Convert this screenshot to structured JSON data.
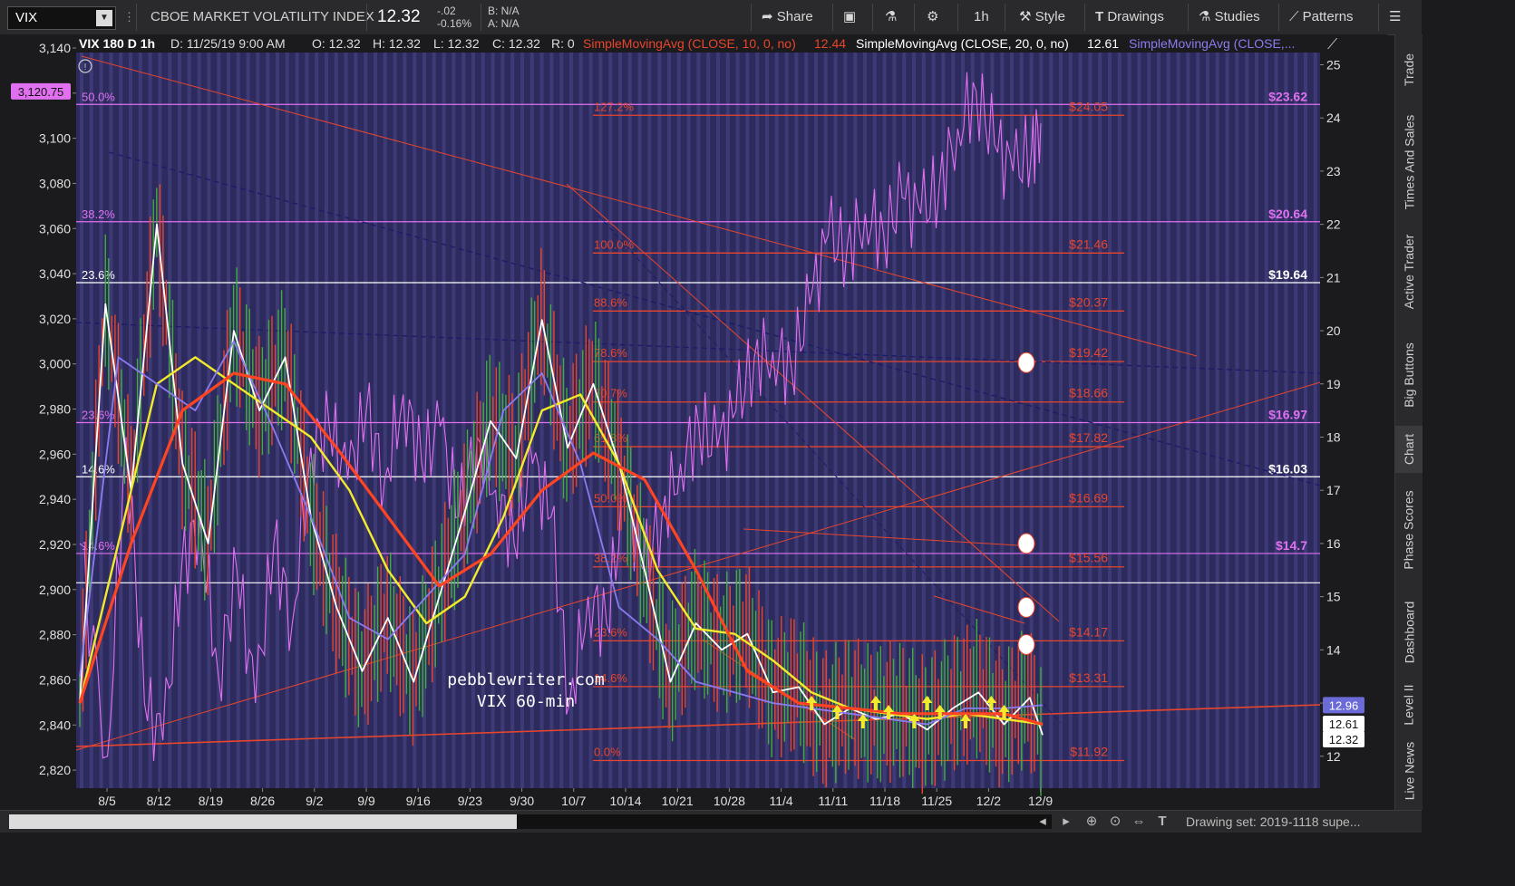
{
  "header": {
    "symbol": "VIX",
    "title": "CBOE MARKET VOLATILITY INDEX",
    "last": "12.32",
    "change": "-.02",
    "change_pct": "-0.16%",
    "bid": "B: N/A",
    "ask": "A: N/A",
    "buttons": {
      "share": "Share",
      "timeframe": "1h",
      "style": "Style",
      "drawings": "Drawings",
      "studies": "Studies",
      "patterns": "Patterns"
    }
  },
  "info_bar": {
    "symbol_tf": "VIX 180 D 1h",
    "date": "D: 11/25/19 9:00 AM",
    "open": "O: 12.32",
    "high": "H: 12.32",
    "low": "L: 12.32",
    "close": "C: 12.32",
    "range": "R: 0",
    "sma10": "SimpleMovingAvg (CLOSE, 10, 0, no)",
    "sma10_val": "12.44",
    "sma20": "SimpleMovingAvg (CLOSE, 20, 0, no)",
    "sma20_val": "12.61",
    "sma50": "SimpleMovingAvg (CLOSE,..."
  },
  "right_tabs": [
    "Trade",
    "Times And Sales",
    "Active Trader",
    "Big Buttons",
    "Chart",
    "Phase Scores",
    "Dashboard",
    "Level II",
    "Live News"
  ],
  "bottom": {
    "drawing_set": "Drawing set: 2019-1118 supe..."
  },
  "colors": {
    "plot_bg": "#2d2b5e",
    "stripe": "#4a4788",
    "fib_red": "#e8452c",
    "magenta": "#e070f0",
    "sma10": "#ffffff",
    "sma20": "#f2ea2a",
    "sma50": "#8a7cf0",
    "sma_long": "#ff4422",
    "arrow": "#f2ea2a",
    "badge_magenta": "#e070f0",
    "badge_blue": "#6b6bd8"
  },
  "chart_data": {
    "type": "line",
    "watermark": [
      "pebblewriter.com",
      "VIX 60-min"
    ],
    "x_ticks": [
      "8/5",
      "8/12",
      "8/19",
      "8/26",
      "9/2",
      "9/9",
      "9/16",
      "9/23",
      "9/30",
      "10/7",
      "10/14",
      "10/21",
      "10/28",
      "11/4",
      "11/11",
      "11/18",
      "11/25",
      "12/2",
      "12/9"
    ],
    "left_axis": {
      "ticks": [
        2820,
        2840,
        2860,
        2880,
        2900,
        2920,
        2940,
        2960,
        2980,
        3000,
        3020,
        3040,
        3060,
        3080,
        3100,
        3120,
        3140
      ],
      "tick_labels": [
        "2,820",
        "2,840",
        "2,860",
        "2,880",
        "2,900",
        "2,920",
        "2,940",
        "2,960",
        "2,980",
        "3,000",
        "3,020",
        "3,040",
        "3,060",
        "3,080",
        "3,100",
        "3,120",
        "3,140"
      ],
      "range": [
        2812,
        3142
      ],
      "badge": "3,120.75",
      "badge_value": 3120.75
    },
    "right_axis": {
      "ticks": [
        12,
        13,
        14,
        15,
        16,
        17,
        18,
        19,
        20,
        21,
        22,
        23,
        24,
        25
      ],
      "range": [
        11.4,
        25.4
      ],
      "badges": [
        {
          "label": "12.96",
          "value": 12.96
        },
        {
          "label": "12.61",
          "value": 12.61
        },
        {
          "label": "12.32",
          "value": 12.32
        }
      ]
    },
    "spx_fib_lines": [
      {
        "left_label": "50.0%",
        "right_label": "$23.62",
        "value": 3115,
        "color": "#e070f0"
      },
      {
        "left_label": "38.2%",
        "right_label": "$20.64",
        "value": 3063,
        "color": "#e070f0"
      },
      {
        "left_label": "23.6%",
        "right_label": "$19.64",
        "value": 3036,
        "color": "#ffffff"
      },
      {
        "left_label": "23.6%",
        "right_label": "$16.97",
        "value": 2974,
        "color": "#e070f0"
      },
      {
        "left_label": "14.6%",
        "right_label": "$16.03",
        "value": 2950,
        "color": "#ffffff"
      },
      {
        "left_label": "14.6%",
        "right_label": "$14.7",
        "value": 2916,
        "color": "#e070f0"
      },
      {
        "left_label": "",
        "right_label": "",
        "value": 2903,
        "color": "#ffffff"
      }
    ],
    "vix_fib_levels": [
      {
        "label": "127.2%",
        "price": "$24.05",
        "value": 24.05
      },
      {
        "label": "100.0%",
        "price": "$21.46",
        "value": 21.46
      },
      {
        "label": "88.6%",
        "price": "$20.37",
        "value": 20.37
      },
      {
        "label": "78.6%",
        "price": "$19.42",
        "value": 19.42
      },
      {
        "label": "70.7%",
        "price": "$18.66",
        "value": 18.66
      },
      {
        "label": "61.8%",
        "price": "$17.82",
        "value": 17.82
      },
      {
        "label": "50.0%",
        "price": "$16.69",
        "value": 16.69
      },
      {
        "label": "38.2%",
        "price": "$15.56",
        "value": 15.56
      },
      {
        "label": "23.6%",
        "price": "$14.17",
        "value": 14.17
      },
      {
        "label": "14.6%",
        "price": "$13.31",
        "value": 13.31
      },
      {
        "label": "0.0%",
        "price": "$11.92",
        "value": 11.92
      }
    ],
    "spx_series_right_scale": [
      {
        "x": 0,
        "y": 16.0
      },
      {
        "x": 3,
        "y": 12.0
      },
      {
        "x": 5,
        "y": 18.0
      },
      {
        "x": 7,
        "y": 13.0
      },
      {
        "x": 9,
        "y": 12.3
      },
      {
        "x": 11,
        "y": 15.5
      },
      {
        "x": 13,
        "y": 16.5
      },
      {
        "x": 15,
        "y": 13.5
      },
      {
        "x": 17,
        "y": 15.5
      },
      {
        "x": 19,
        "y": 13.0
      },
      {
        "x": 21,
        "y": 16.0
      },
      {
        "x": 23,
        "y": 14.5
      },
      {
        "x": 25,
        "y": 17.8
      },
      {
        "x": 27,
        "y": 18.2
      },
      {
        "x": 29,
        "y": 17.2
      },
      {
        "x": 31,
        "y": 18.5
      },
      {
        "x": 33,
        "y": 17.2
      },
      {
        "x": 35,
        "y": 18.8
      },
      {
        "x": 37,
        "y": 17.5
      },
      {
        "x": 39,
        "y": 18.2
      },
      {
        "x": 41,
        "y": 16.5
      },
      {
        "x": 43,
        "y": 18.0
      },
      {
        "x": 45,
        "y": 17.0
      },
      {
        "x": 47,
        "y": 16.0
      },
      {
        "x": 49,
        "y": 17.5
      },
      {
        "x": 51,
        "y": 16.5
      },
      {
        "x": 53,
        "y": 13.0
      },
      {
        "x": 55,
        "y": 15.0
      },
      {
        "x": 57,
        "y": 14.5
      },
      {
        "x": 59,
        "y": 17.0
      },
      {
        "x": 61,
        "y": 15.5
      },
      {
        "x": 63,
        "y": 16.5
      },
      {
        "x": 65,
        "y": 17.5
      },
      {
        "x": 67,
        "y": 18.2
      },
      {
        "x": 69,
        "y": 17.8
      },
      {
        "x": 71,
        "y": 18.5
      },
      {
        "x": 73,
        "y": 19.5
      },
      {
        "x": 75,
        "y": 19.6
      },
      {
        "x": 77,
        "y": 19.3
      },
      {
        "x": 79,
        "y": 20.5
      },
      {
        "x": 81,
        "y": 21.8
      },
      {
        "x": 83,
        "y": 21.5
      },
      {
        "x": 85,
        "y": 22.2
      },
      {
        "x": 87,
        "y": 21.8
      },
      {
        "x": 89,
        "y": 22.5
      },
      {
        "x": 91,
        "y": 22.2
      },
      {
        "x": 93,
        "y": 22.7
      },
      {
        "x": 95,
        "y": 23.8
      },
      {
        "x": 97,
        "y": 24.5
      },
      {
        "x": 99,
        "y": 23.5
      },
      {
        "x": 101,
        "y": 23.0
      },
      {
        "x": 103,
        "y": 23.4
      },
      {
        "x": 104,
        "y": 23.9
      }
    ],
    "series": [
      {
        "name": "SimpleMovingAvg (CLOSE, 10, 0, no)",
        "color": "#ffffff",
        "values": [
          {
            "x": 0,
            "y": 13.0
          },
          {
            "x": 2,
            "y": 20.5
          },
          {
            "x": 4,
            "y": 17.0
          },
          {
            "x": 6,
            "y": 22.0
          },
          {
            "x": 8,
            "y": 17.5
          },
          {
            "x": 10,
            "y": 16.0
          },
          {
            "x": 12,
            "y": 20.0
          },
          {
            "x": 14,
            "y": 18.5
          },
          {
            "x": 16,
            "y": 19.5
          },
          {
            "x": 18,
            "y": 16.5
          },
          {
            "x": 20,
            "y": 14.8
          },
          {
            "x": 22,
            "y": 13.6
          },
          {
            "x": 24,
            "y": 14.6
          },
          {
            "x": 26,
            "y": 13.4
          },
          {
            "x": 28,
            "y": 15.0
          },
          {
            "x": 30,
            "y": 16.6
          },
          {
            "x": 32,
            "y": 18.3
          },
          {
            "x": 34,
            "y": 17.6
          },
          {
            "x": 36,
            "y": 20.2
          },
          {
            "x": 38,
            "y": 17.8
          },
          {
            "x": 40,
            "y": 19.0
          },
          {
            "x": 42,
            "y": 17.5
          },
          {
            "x": 44,
            "y": 15.5
          },
          {
            "x": 46,
            "y": 13.4
          },
          {
            "x": 48,
            "y": 14.5
          },
          {
            "x": 50,
            "y": 14.0
          },
          {
            "x": 52,
            "y": 14.3
          },
          {
            "x": 54,
            "y": 13.2
          },
          {
            "x": 56,
            "y": 13.3
          },
          {
            "x": 58,
            "y": 12.6
          },
          {
            "x": 60,
            "y": 12.9
          },
          {
            "x": 62,
            "y": 12.7
          },
          {
            "x": 64,
            "y": 12.8
          },
          {
            "x": 66,
            "y": 12.5
          },
          {
            "x": 68,
            "y": 12.9
          },
          {
            "x": 70,
            "y": 13.2
          },
          {
            "x": 72,
            "y": 12.6
          },
          {
            "x": 74,
            "y": 13.1
          },
          {
            "x": 75,
            "y": 12.4
          }
        ]
      },
      {
        "name": "SimpleMovingAvg (CLOSE, 20, 0, no)",
        "color": "#f2ea2a",
        "values": [
          {
            "x": 0,
            "y": 13.0
          },
          {
            "x": 3,
            "y": 16.0
          },
          {
            "x": 6,
            "y": 19.0
          },
          {
            "x": 9,
            "y": 19.5
          },
          {
            "x": 12,
            "y": 19.0
          },
          {
            "x": 15,
            "y": 18.5
          },
          {
            "x": 18,
            "y": 18.0
          },
          {
            "x": 21,
            "y": 17.0
          },
          {
            "x": 24,
            "y": 15.5
          },
          {
            "x": 27,
            "y": 14.5
          },
          {
            "x": 30,
            "y": 15.0
          },
          {
            "x": 33,
            "y": 16.5
          },
          {
            "x": 36,
            "y": 18.5
          },
          {
            "x": 39,
            "y": 18.8
          },
          {
            "x": 42,
            "y": 17.5
          },
          {
            "x": 45,
            "y": 15.5
          },
          {
            "x": 48,
            "y": 14.4
          },
          {
            "x": 51,
            "y": 14.3
          },
          {
            "x": 54,
            "y": 13.8
          },
          {
            "x": 57,
            "y": 13.2
          },
          {
            "x": 60,
            "y": 12.9
          },
          {
            "x": 63,
            "y": 12.8
          },
          {
            "x": 66,
            "y": 12.7
          },
          {
            "x": 69,
            "y": 12.8
          },
          {
            "x": 72,
            "y": 12.7
          },
          {
            "x": 75,
            "y": 12.6
          }
        ]
      },
      {
        "name": "SimpleMovingAvg (CLOSE,...",
        "color": "#8a7cf0",
        "values": [
          {
            "x": 0,
            "y": 13.5
          },
          {
            "x": 3,
            "y": 19.5
          },
          {
            "x": 6,
            "y": 19.0
          },
          {
            "x": 9,
            "y": 18.5
          },
          {
            "x": 12,
            "y": 19.8
          },
          {
            "x": 15,
            "y": 18.2
          },
          {
            "x": 18,
            "y": 16.5
          },
          {
            "x": 21,
            "y": 14.6
          },
          {
            "x": 24,
            "y": 14.2
          },
          {
            "x": 27,
            "y": 15.0
          },
          {
            "x": 30,
            "y": 15.8
          },
          {
            "x": 33,
            "y": 18.5
          },
          {
            "x": 36,
            "y": 19.2
          },
          {
            "x": 39,
            "y": 17.5
          },
          {
            "x": 42,
            "y": 14.8
          },
          {
            "x": 45,
            "y": 14.2
          },
          {
            "x": 48,
            "y": 13.4
          },
          {
            "x": 51,
            "y": 13.2
          },
          {
            "x": 54,
            "y": 13.0
          },
          {
            "x": 57,
            "y": 12.9
          },
          {
            "x": 60,
            "y": 12.8
          },
          {
            "x": 63,
            "y": 12.7
          },
          {
            "x": 66,
            "y": 12.6
          },
          {
            "x": 69,
            "y": 12.9
          },
          {
            "x": 72,
            "y": 12.9
          },
          {
            "x": 75,
            "y": 12.96
          }
        ]
      },
      {
        "name": "",
        "color": "#ff4422",
        "values": [
          {
            "x": 0,
            "y": 13.0
          },
          {
            "x": 4,
            "y": 16.0
          },
          {
            "x": 8,
            "y": 18.5
          },
          {
            "x": 12,
            "y": 19.2
          },
          {
            "x": 16,
            "y": 19.0
          },
          {
            "x": 20,
            "y": 17.8
          },
          {
            "x": 24,
            "y": 16.5
          },
          {
            "x": 28,
            "y": 15.2
          },
          {
            "x": 32,
            "y": 15.8
          },
          {
            "x": 36,
            "y": 17.0
          },
          {
            "x": 40,
            "y": 17.7
          },
          {
            "x": 44,
            "y": 17.2
          },
          {
            "x": 48,
            "y": 15.5
          },
          {
            "x": 52,
            "y": 13.6
          },
          {
            "x": 56,
            "y": 13.0
          },
          {
            "x": 60,
            "y": 12.9
          },
          {
            "x": 64,
            "y": 12.8
          },
          {
            "x": 68,
            "y": 12.8
          },
          {
            "x": 72,
            "y": 12.8
          },
          {
            "x": 75,
            "y": 12.6
          }
        ]
      }
    ],
    "markers": {
      "up_arrows_x": [
        57,
        59,
        61,
        62,
        63,
        65,
        66,
        67,
        69,
        71,
        72
      ],
      "circles_right_scale": [
        19.4,
        16.0,
        14.8,
        14.1
      ]
    }
  }
}
